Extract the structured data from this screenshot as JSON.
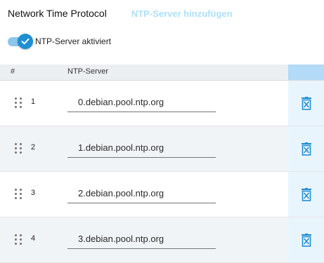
{
  "header": {
    "title": "Network Time Protocol",
    "add_label": "NTP-Server hinzufügen"
  },
  "toggle": {
    "label": "NTP-Server aktiviert",
    "enabled": true
  },
  "table": {
    "columns": [
      "#",
      "NTP-Server"
    ],
    "rows": [
      {
        "index": "1",
        "server": "0.debian.pool.ntp.org"
      },
      {
        "index": "2",
        "server": "1.debian.pool.ntp.org"
      },
      {
        "index": "3",
        "server": "2.debian.pool.ntp.org"
      },
      {
        "index": "4",
        "server": "3.debian.pool.ntp.org"
      }
    ]
  },
  "icons": {
    "drag": "drag-handle-icon",
    "delete": "delete-icon",
    "check": "check-icon"
  },
  "colors": {
    "accent": "#1f8fd3",
    "accent_light": "#aee0f9",
    "header_bg": "#eceff1",
    "action_col_bg": "#b3daf6"
  }
}
